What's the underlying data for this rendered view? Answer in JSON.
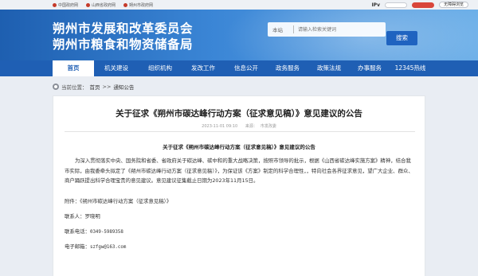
{
  "topbar": {
    "links": [
      "中国政府网",
      "山西省政府网",
      "朔州市政府网"
    ],
    "ipv": "IPv",
    "accessibility": "无障碍浏览"
  },
  "header": {
    "title_line1": "朔州市发展和改革委员会",
    "title_line2": "朔州市粮食和物资储备局",
    "search_label": "本站",
    "search_placeholder": "请输入检索关键词",
    "search_button": "搜索"
  },
  "nav": {
    "items": [
      "首页",
      "机关建设",
      "组织机构",
      "发改工作",
      "信息公开",
      "政务服务",
      "政策法规",
      "办事服务",
      "12345热线"
    ]
  },
  "breadcrumb": {
    "label": "当前位置：",
    "home": "首页",
    "sep": ">>",
    "current": "通知公告"
  },
  "article": {
    "title": "关于征求《朔州市碳达峰行动方案（征求意见稿）》意见建议的公告",
    "date": "2023-11-01 09:10",
    "source": "来源：",
    "author": "市发改委",
    "subtitle": "关于征求《朔州市碳达峰行动方案（征求意见稿）》意见建议的公告",
    "body": "为深入贯彻落实中央、国务院和省委、省政府关于碳达峰、碳中和的重大战略决策，按照市领导的批示，根据《山西省碳达峰实施方案》精神，结合我市实际，由我委牵头拟定了《朔州市碳达峰行动方案（征求意见稿）》，为保证该《方案》制定的科学合理性，，特向社会各界征求意见，望广大企业、群众、商户踊跃提出科学合理宝贵的意见建议。意见建议征集截止日期为2023年11月15日。",
    "attachment": "附件：《朔州市碳达峰行动方案（征求意见稿）》",
    "contact_label": "联系人：",
    "contact_name": "罗晓明",
    "phone_label": "联系电话：",
    "phone": "0349-5989358",
    "email_label": "电子邮箱：",
    "email": "szfgw@163.com"
  },
  "colors": {
    "brand_blue": "#1f5fb4",
    "header_gradient_start": "#1e5fb0",
    "header_gradient_end": "#6aaee8",
    "gov_red": "#c53b2b"
  }
}
